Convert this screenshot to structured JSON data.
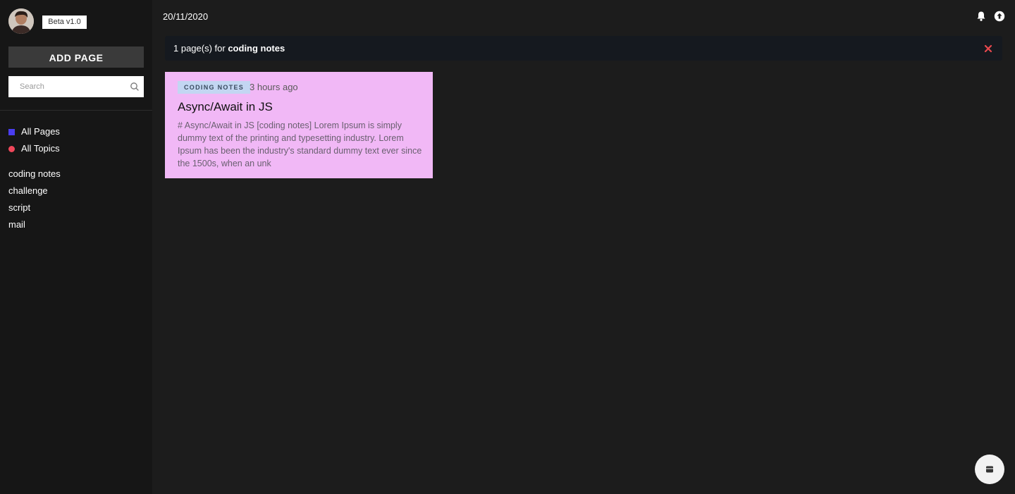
{
  "sidebar": {
    "beta_label": "Beta v1.0",
    "add_page_label": "ADD PAGE",
    "search_placeholder": "Search",
    "nav": [
      {
        "label": "All Pages",
        "color": "#4a3df0"
      },
      {
        "label": "All Topics",
        "color": "#f0475a"
      }
    ],
    "topics": [
      "coding notes",
      "challenge",
      "script",
      "mail"
    ]
  },
  "header": {
    "date": "20/11/2020"
  },
  "results": {
    "count_text": "1 page(s) for",
    "query": "coding notes"
  },
  "cards": [
    {
      "tag": "CODING NOTES",
      "time_ago": "3 hours ago",
      "title": "Async/Await in JS",
      "excerpt": "# Async/Await in JS [coding notes] Lorem Ipsum is simply dummy text of the printing and typesetting industry. Lorem Ipsum has been the industry's standard dummy text ever since the 1500s, when an unk",
      "color": "#f1b8f6"
    }
  ],
  "icons": {
    "avatar": "user-avatar",
    "search": "search-icon",
    "bell": "bell-icon",
    "upload": "upload-icon",
    "close": "close-icon",
    "fab": "archive-icon"
  }
}
